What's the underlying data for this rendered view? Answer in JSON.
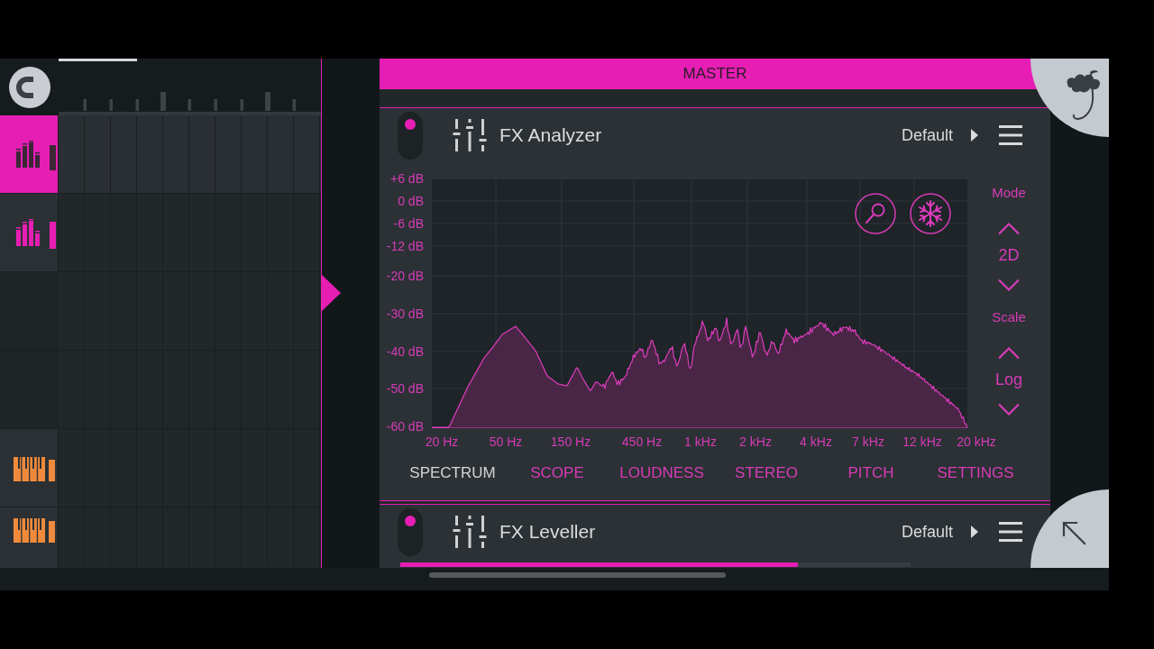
{
  "playlist": {
    "tracks": [
      {
        "kind": "audio",
        "selected": true
      },
      {
        "kind": "audio",
        "selected": false
      },
      {
        "kind": "empty",
        "selected": false
      },
      {
        "kind": "empty",
        "selected": false
      },
      {
        "kind": "instrument",
        "selected": false
      },
      {
        "kind": "instrument",
        "selected": false
      }
    ]
  },
  "mixer": {
    "title": "MASTER",
    "effects": [
      {
        "kind": "analyzer",
        "name": "FX Analyzer",
        "on": true,
        "preset": "Default",
        "y_labels": [
          "+6 dB",
          "0 dB",
          "-6 dB",
          "-12 dB",
          "-20 dB",
          "-30 dB",
          "-40 dB",
          "-50 dB",
          "-60 dB"
        ],
        "x_labels": [
          "20 Hz",
          "50 Hz",
          "150 Hz",
          "450 Hz",
          "1 kHz",
          "2 kHz",
          "4 kHz",
          "7 kHz",
          "12 kHz",
          "20 kHz"
        ],
        "settings": [
          {
            "label": "Mode",
            "value": "2D"
          },
          {
            "label": "Scale",
            "value": "Log"
          }
        ],
        "tabs": [
          {
            "label": "SPECTRUM",
            "selected": true
          },
          {
            "label": "SCOPE",
            "selected": false
          },
          {
            "label": "LOUDNESS",
            "selected": false
          },
          {
            "label": "STEREO",
            "selected": false
          },
          {
            "label": "PITCH",
            "selected": false
          },
          {
            "label": "SETTINGS",
            "selected": false
          }
        ]
      },
      {
        "kind": "leveller",
        "name": "FX Leveller",
        "on": true,
        "preset": "Default",
        "level": 0.78
      }
    ]
  }
}
